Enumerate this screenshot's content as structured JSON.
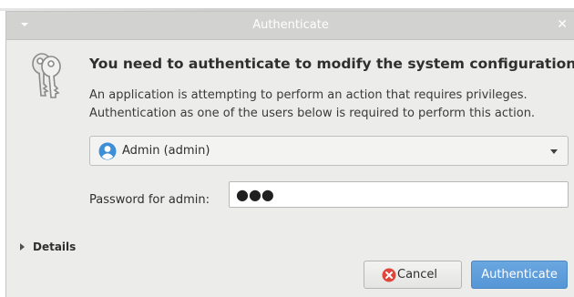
{
  "window": {
    "title": "Authenticate",
    "close_glyph": "✕",
    "menu_icon": "triangle-down-icon"
  },
  "dialog": {
    "icon": "keys-icon",
    "heading": "You need to authenticate to modify the system configuration",
    "message_line1": "An application is attempting to perform an action that requires privileges.",
    "message_line2": "Authentication as one of the users below is required to perform this action."
  },
  "user_select": {
    "selected": "Admin (admin)",
    "icon": "user-avatar-icon"
  },
  "password": {
    "label": "Password for admin:",
    "masked_value": "●●●"
  },
  "details": {
    "label": "Details"
  },
  "buttons": {
    "cancel_label": "Cancel",
    "authenticate_label": "Authenticate"
  },
  "colors": {
    "accent": "#5596d6",
    "cancel_icon": "#e0463c",
    "avatar": "#3d8fd8"
  }
}
